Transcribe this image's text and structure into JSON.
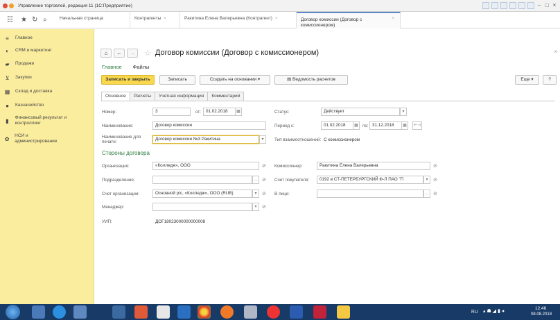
{
  "window": {
    "title": "Управление торговлей, редакция 11  (1С:Предприятие)"
  },
  "tabs": [
    {
      "label": "Начальная страница"
    },
    {
      "label": "Контрагенты"
    },
    {
      "label": "Ракитина Елена Валерьевна (Контрагент)"
    },
    {
      "label": "Договор комиссии (Договор с комиссионером)"
    }
  ],
  "sidebar": {
    "items": [
      {
        "label": "Главное",
        "icon": "menu-icon"
      },
      {
        "label": "CRM и маркетинг",
        "icon": "crm-icon"
      },
      {
        "label": "Продажи",
        "icon": "sales-bag-icon"
      },
      {
        "label": "Закупки",
        "icon": "cart-icon"
      },
      {
        "label": "Склад и доставка",
        "icon": "warehouse-icon"
      },
      {
        "label": "Казначейство",
        "icon": "treasury-icon"
      },
      {
        "label": "Финансовый результат и контроллинг",
        "icon": "chart-icon"
      },
      {
        "label": "НСИ и администрирование",
        "icon": "gear-icon"
      }
    ]
  },
  "document": {
    "title": "Договор комиссии (Договор с комиссионером)",
    "sublinks": {
      "main": "Главное",
      "files": "Файлы"
    }
  },
  "toolbar": {
    "save_close": "Записать и закрыть",
    "save": "Записать",
    "create_based": "Создать на основании",
    "statement": "Ведомость расчетов",
    "more": "Еще",
    "help": "?"
  },
  "form_tabs": [
    "Основное",
    "Расчеты",
    "Учетная информация",
    "Комментарий"
  ],
  "form": {
    "number_label": "Номер:",
    "number_value": "3",
    "from_label": "от:",
    "date_value": "01.02.2018",
    "status_label": "Статус:",
    "status_value": "Действует",
    "name_label": "Наименование:",
    "name_value": "Договор комиссии",
    "period_label": "Период с:",
    "period_from": "01.02.2018",
    "period_to_label": "по:",
    "period_to": "31.12.2018",
    "print_name_label": "Наименование для печати:",
    "print_name_value": "Договор комиссии №3 Ракитина",
    "relation_label": "Тип взаимоотношений:",
    "relation_value": "С комиссионером",
    "section_title": "Стороны договора",
    "org_label": "Организация:",
    "org_value": "«Колледж», ООО",
    "agent_label": "Комиссионер:",
    "agent_value": "Ракитина Елена Валерьевна",
    "division_label": "Подразделение:",
    "division_value": "",
    "buyer_account_label": "Счет покупателя:",
    "buyer_account_value": "0192 в СТ-ПЕТЕРБУРГСКИЙ Ф-Л ПАО \"П",
    "org_account_label": "Счет организации:",
    "org_account_value": "Основной р/с, «Колледж», ООО (RUB)",
    "person_label": "В лице:",
    "person_value": "",
    "manager_label": "Менеджер:",
    "manager_value": "",
    "uip_label": "УИП:",
    "uip_value": "ДОГ18023000000000008"
  },
  "taskbar": {
    "lang": "RU",
    "time": "12:46",
    "date": "08.08.2018"
  }
}
